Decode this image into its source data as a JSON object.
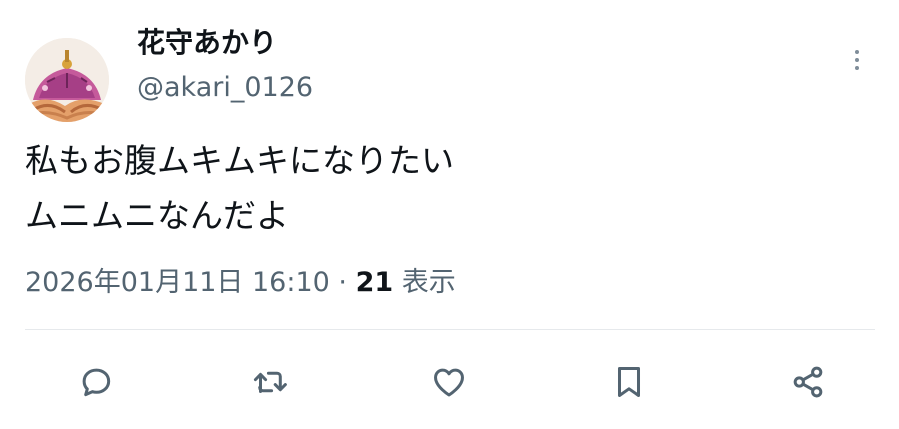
{
  "user": {
    "display_name": "花守あかり",
    "handle": "@akari_0126",
    "avatar_icon": "avatar-illustration"
  },
  "tweet": {
    "lines": [
      "私もお腹ムキムキになりたい",
      "ムニムニなんだよ"
    ],
    "timestamp": "2026年01月11日 16:10",
    "separator": "·",
    "views_count": "21",
    "views_label": "表示"
  },
  "actions": {
    "reply_icon": "reply-icon",
    "retweet_icon": "retweet-icon",
    "like_icon": "like-icon",
    "bookmark_icon": "bookmark-icon",
    "share_icon": "share-icon"
  },
  "colors": {
    "text_primary": "#0f1419",
    "text_secondary": "#536471",
    "icon_gray": "#536471",
    "divider": "#e6e9ec"
  }
}
